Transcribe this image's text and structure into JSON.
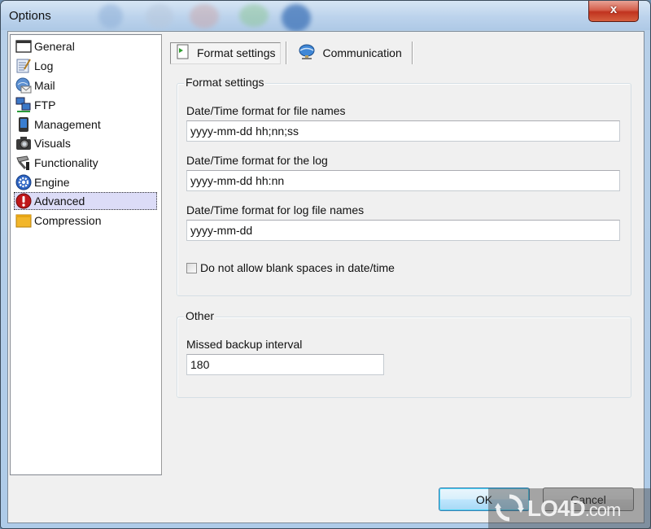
{
  "window": {
    "title": "Options",
    "close_glyph": "x"
  },
  "sidebar": {
    "items": [
      {
        "label": "General",
        "icon": "window-icon"
      },
      {
        "label": "Log",
        "icon": "notepad-icon"
      },
      {
        "label": "Mail",
        "icon": "mail-globe-icon"
      },
      {
        "label": "FTP",
        "icon": "network-computers-icon"
      },
      {
        "label": "Management",
        "icon": "handheld-device-icon"
      },
      {
        "label": "Visuals",
        "icon": "camera-icon"
      },
      {
        "label": "Functionality",
        "icon": "tools-icon"
      },
      {
        "label": "Engine",
        "icon": "gear-icon"
      },
      {
        "label": "Advanced",
        "icon": "warning-icon",
        "selected": true
      },
      {
        "label": "Compression",
        "icon": "folder-icon"
      }
    ]
  },
  "tabs": [
    {
      "label": "Format settings",
      "icon": "document-arrow-icon",
      "active": true
    },
    {
      "label": "Communication",
      "icon": "globe-network-icon",
      "active": false
    }
  ],
  "format_group": {
    "title": "Format settings",
    "fields": [
      {
        "label": "Date/Time format for file names",
        "value": "yyyy-mm-dd hh;nn;ss"
      },
      {
        "label": "Date/Time format for the log",
        "value": "yyyy-mm-dd hh:nn"
      },
      {
        "label": "Date/Time format for log file names",
        "value": "yyyy-mm-dd"
      }
    ],
    "checkbox": {
      "label": "Do not allow blank spaces in date/time",
      "checked": false
    }
  },
  "other_group": {
    "title": "Other",
    "fields": [
      {
        "label": "Missed backup interval",
        "value": "180"
      }
    ]
  },
  "buttons": {
    "ok": "OK",
    "cancel": "Cancel"
  },
  "watermark": {
    "text": "LO4D",
    "suffix": ".com"
  }
}
